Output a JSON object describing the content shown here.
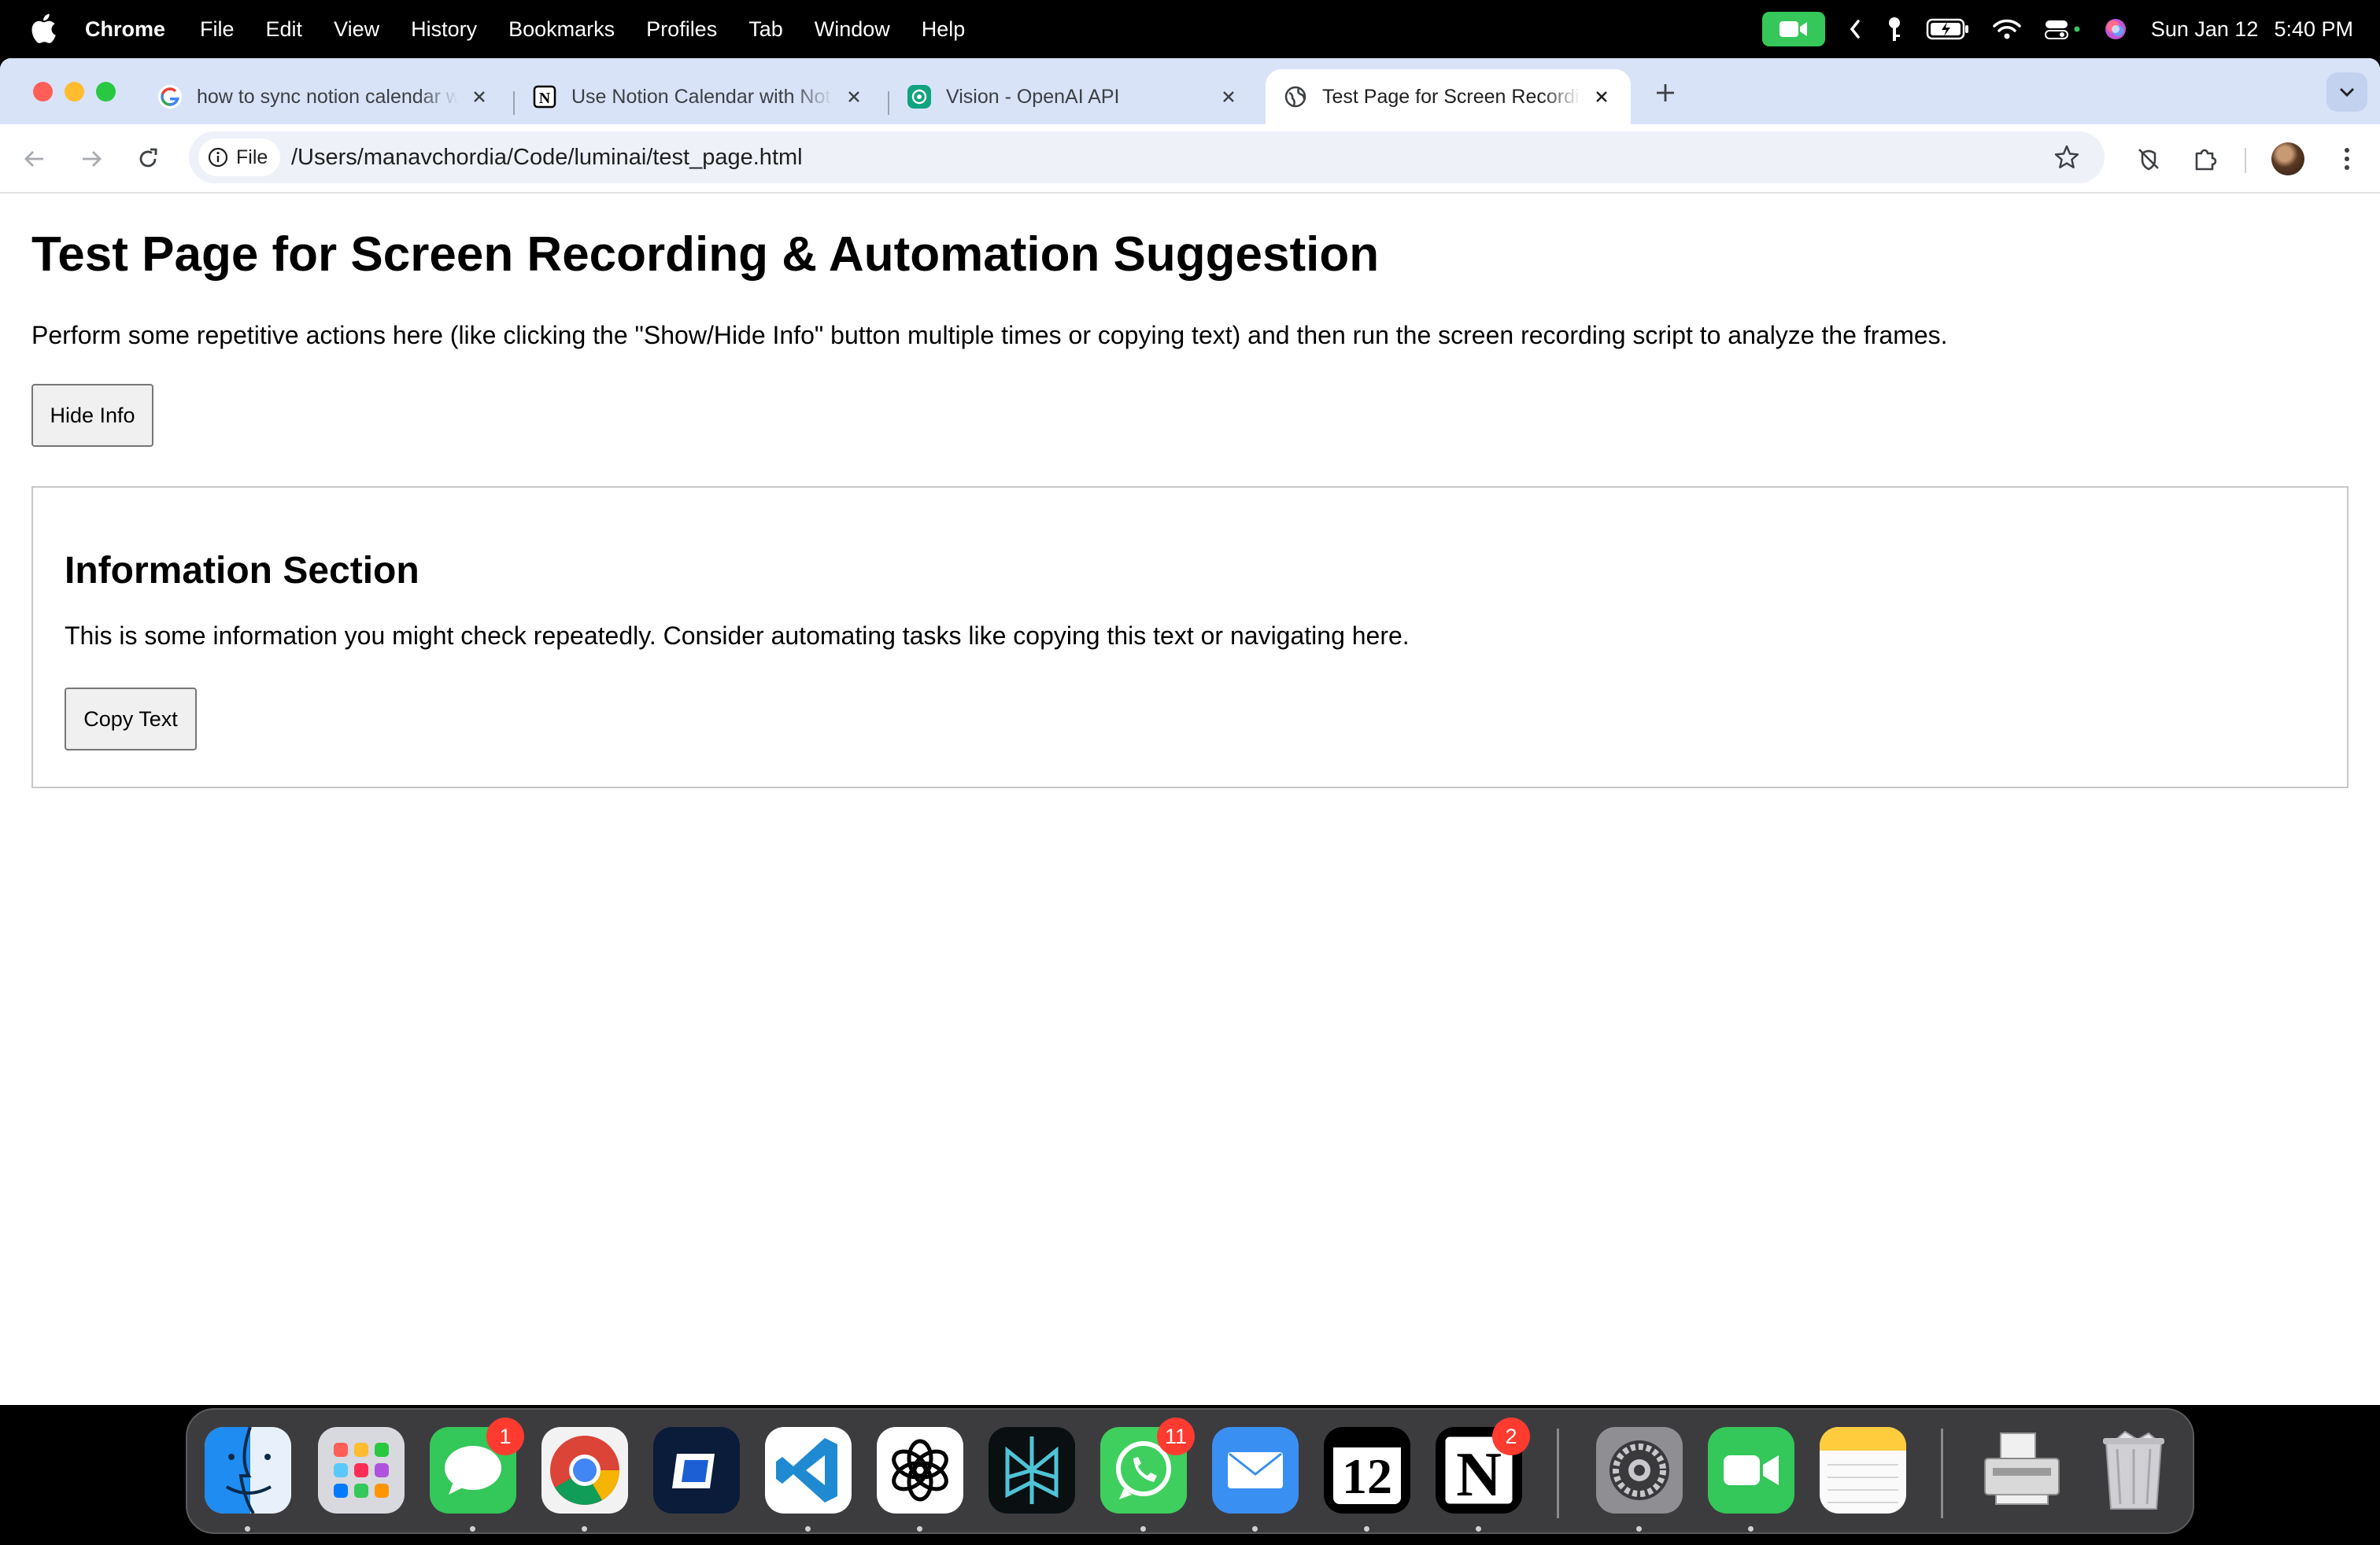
{
  "menubar": {
    "app_name": "Chrome",
    "menus": [
      "File",
      "Edit",
      "View",
      "History",
      "Bookmarks",
      "Profiles",
      "Tab",
      "Window",
      "Help"
    ],
    "date": "Sun Jan 12",
    "time": "5:40 PM",
    "facetime_color": "#35c759"
  },
  "tabs": [
    {
      "title": "how to sync notion calendar w",
      "icon": "google-icon"
    },
    {
      "title": "Use Notion Calendar with Not",
      "icon": "notion-icon"
    },
    {
      "title": "Vision - OpenAI API",
      "icon": "openai-icon"
    },
    {
      "title": "Test Page for Screen Recordin",
      "icon": "globe-icon",
      "active": true
    }
  ],
  "toolbar": {
    "site_info_label": "File",
    "url": "/Users/manavchordia/Code/luminai/test_page.html"
  },
  "page": {
    "title": "Test Page for Screen Recording & Automation Suggestion",
    "intro": "Perform some repetitive actions here (like clicking the \"Show/Hide Info\" button multiple times or copying text) and then run the screen recording script to analyze the frames.",
    "hide_button": "Hide Info",
    "info": {
      "heading": "Information Section",
      "text": "This is some information you might check repeatedly. Consider automating tasks like copying this text or navigating here.",
      "copy_button": "Copy Text"
    }
  },
  "dock": {
    "items": [
      {
        "name": "finder",
        "badge": null
      },
      {
        "name": "launchpad",
        "badge": null
      },
      {
        "name": "messages",
        "badge": "1"
      },
      {
        "name": "chrome",
        "badge": null
      },
      {
        "name": "microsoft-remote",
        "badge": null
      },
      {
        "name": "vscode",
        "badge": null
      },
      {
        "name": "chatgpt",
        "badge": null
      },
      {
        "name": "perplexity",
        "badge": null
      },
      {
        "name": "whatsapp",
        "badge": "11"
      },
      {
        "name": "mail",
        "badge": null
      },
      {
        "name": "notion-calendar",
        "badge": null,
        "label": "12"
      },
      {
        "name": "notion",
        "badge": "2",
        "label": "N"
      },
      {
        "name": "system-settings",
        "badge": null
      },
      {
        "name": "facetime",
        "badge": null
      },
      {
        "name": "notes",
        "badge": null
      },
      {
        "name": "scanner",
        "badge": null
      },
      {
        "name": "trash",
        "badge": null
      }
    ]
  }
}
